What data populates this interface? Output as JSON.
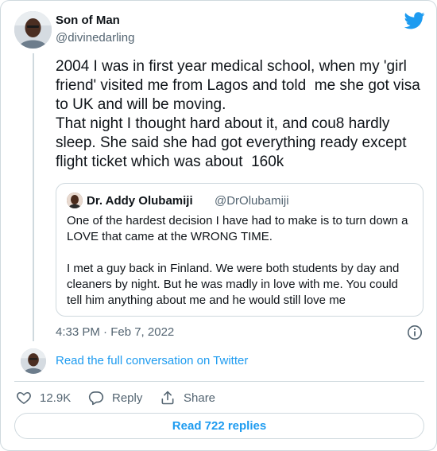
{
  "author": {
    "name": "Son of Man",
    "handle": "@divinedarling"
  },
  "tweet": {
    "text": "2004 I was in first year medical school, when my 'girl friend' visited me from Lagos and told  me she got visa to UK and will be moving.\nThat night I thought hard about it, and cou8 hardly sleep. She said she had got everything ready except flight ticket which was about  160k",
    "timestamp": "4:33 PM · Feb 7, 2022"
  },
  "quoted_tweet": {
    "name": "Dr. Addy Olubamiji",
    "handle": "@DrOlubamiji",
    "paragraph1": "One of the hardest decision I have had to make is to turn down a LOVE that came at the WRONG TIME.",
    "paragraph2": "I met a guy back in Finland. We were both students by day and cleaners by night. But he was madly in love with me. You could tell him anything about me and he would still love me"
  },
  "links": {
    "read_conversation": "Read the full conversation on Twitter"
  },
  "actions": {
    "like_count": "12.9K",
    "reply_label": "Reply",
    "share_label": "Share",
    "read_replies": "Read 722 replies"
  },
  "icons": {
    "brand": "twitter-bird-icon",
    "like": "heart-icon",
    "reply": "speech-bubble-icon",
    "share": "share-upload-icon",
    "info": "info-icon"
  },
  "colors": {
    "accent": "#1d9bf0",
    "text_primary": "#0f1419",
    "text_secondary": "#536471",
    "border": "#cfd9de"
  }
}
